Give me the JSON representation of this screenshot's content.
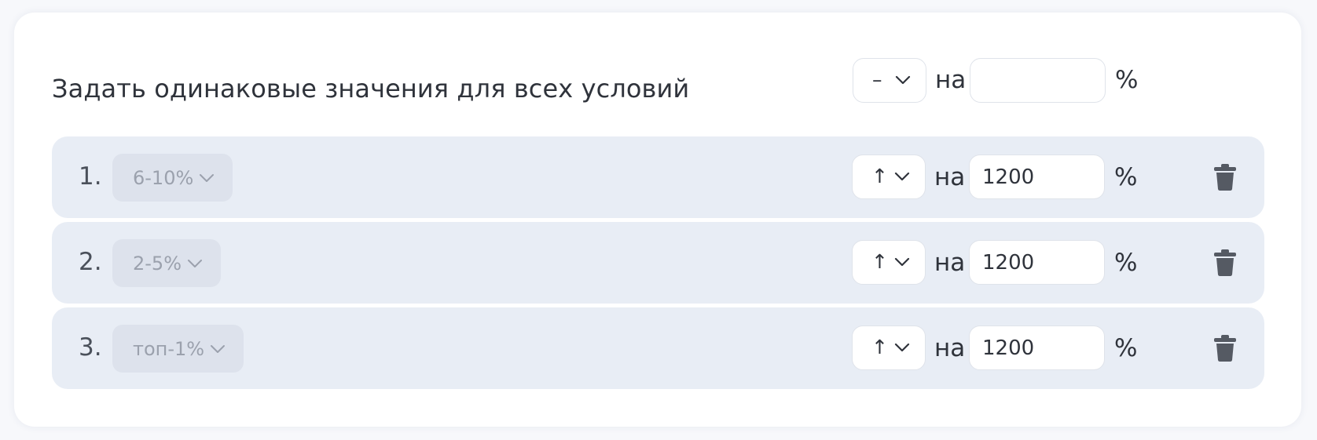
{
  "bulk": {
    "title": "Задать одинаковые значения для всех условий",
    "direction": "–",
    "on_label": "на",
    "value": "",
    "percent": "%"
  },
  "conditions": [
    {
      "index": "1.",
      "range": "6-10%",
      "direction": "↑",
      "on_label": "на",
      "value": "1200",
      "percent": "%"
    },
    {
      "index": "2.",
      "range": "2-5%",
      "direction": "↑",
      "on_label": "на",
      "value": "1200",
      "percent": "%"
    },
    {
      "index": "3.",
      "range": "топ-1%",
      "direction": "↑",
      "on_label": "на",
      "value": "1200",
      "percent": "%"
    }
  ],
  "icons": {
    "chevron": "chevron-down-icon",
    "delete": "trash-icon"
  },
  "colors": {
    "card_bg": "#ffffff",
    "row_bg": "#e8edf5",
    "chip_bg": "#dde2ec",
    "text": "#2f333b",
    "muted_text": "#9ba1ad",
    "icon": "#555a63"
  }
}
